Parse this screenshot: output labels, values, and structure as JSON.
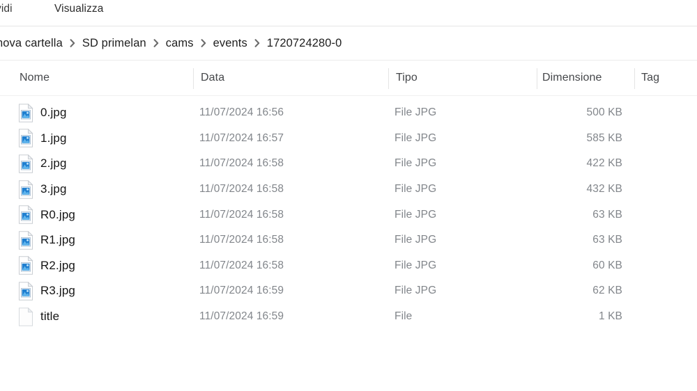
{
  "window": {
    "app": "File Explorer",
    "menu_items": [
      {
        "label": "vidi",
        "clipped": true
      },
      {
        "label": "Visualizza",
        "clipped": false
      }
    ]
  },
  "breadcrumb": {
    "name": "address-bar",
    "separator_icon": "chevron-right-icon",
    "items": [
      "nova cartella",
      "SD primelan",
      "cams",
      "events",
      "1720724280-0"
    ]
  },
  "columns": {
    "sort_icon": "chevron-up-icon",
    "sort_column": "Nome",
    "sort_direction": "ascending",
    "headers": [
      "Nome",
      "Data",
      "Tipo",
      "Dimensione",
      "Tag"
    ]
  },
  "files": [
    {
      "name": "0.jpg",
      "date": "11/07/2024 16:56",
      "type": "File JPG",
      "size": "500 KB",
      "tag": "",
      "icon": "jpg-file-icon"
    },
    {
      "name": "1.jpg",
      "date": "11/07/2024 16:57",
      "type": "File JPG",
      "size": "585 KB",
      "tag": "",
      "icon": "jpg-file-icon"
    },
    {
      "name": "2.jpg",
      "date": "11/07/2024 16:58",
      "type": "File JPG",
      "size": "422 KB",
      "tag": "",
      "icon": "jpg-file-icon"
    },
    {
      "name": "3.jpg",
      "date": "11/07/2024 16:58",
      "type": "File JPG",
      "size": "432 KB",
      "tag": "",
      "icon": "jpg-file-icon"
    },
    {
      "name": "R0.jpg",
      "date": "11/07/2024 16:58",
      "type": "File JPG",
      "size": "63 KB",
      "tag": "",
      "icon": "jpg-file-icon"
    },
    {
      "name": "R1.jpg",
      "date": "11/07/2024 16:58",
      "type": "File JPG",
      "size": "63 KB",
      "tag": "",
      "icon": "jpg-file-icon"
    },
    {
      "name": "R2.jpg",
      "date": "11/07/2024 16:58",
      "type": "File JPG",
      "size": "60 KB",
      "tag": "",
      "icon": "jpg-file-icon"
    },
    {
      "name": "R3.jpg",
      "date": "11/07/2024 16:59",
      "type": "File JPG",
      "size": "62 KB",
      "tag": "",
      "icon": "jpg-file-icon"
    },
    {
      "name": "title",
      "date": "11/07/2024 16:59",
      "type": "File",
      "size": "1 KB",
      "tag": "",
      "icon": "blank-file-icon"
    }
  ],
  "colors": {
    "background": "#ffffff",
    "name_text": "#161616",
    "secondary_text": "#82868b",
    "header_text": "#45474a",
    "divider": "#e6e6e6",
    "icon_blue": "#2b7fd4"
  }
}
